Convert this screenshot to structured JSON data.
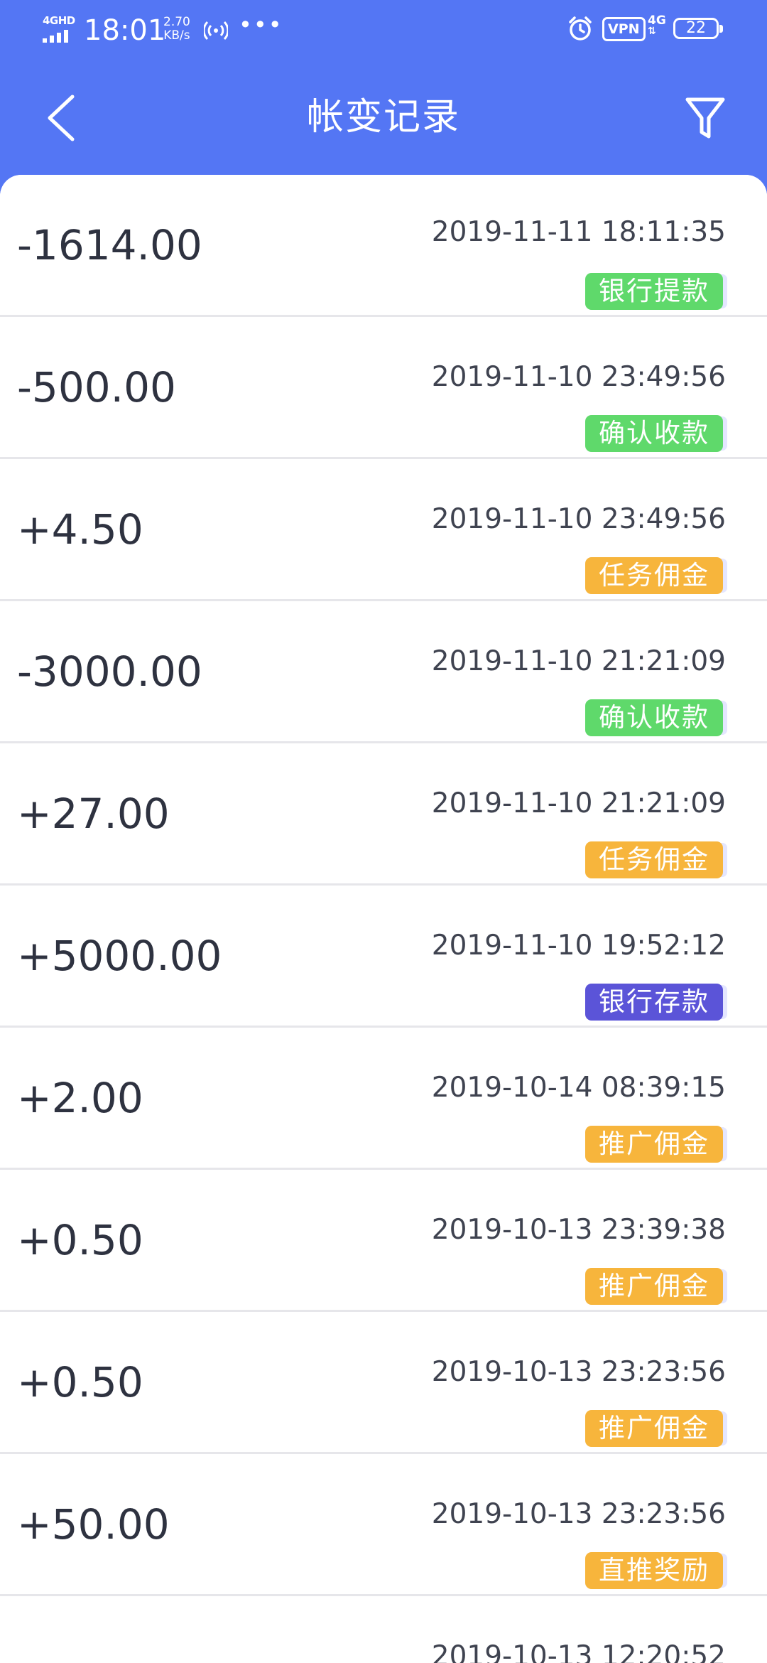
{
  "status_bar": {
    "network_type": "4GHD",
    "time": "18:01",
    "speed_value": "2.70",
    "speed_unit": "KB/s",
    "more": "•••",
    "vpn": "VPN",
    "cell": "4G",
    "battery": "22"
  },
  "nav": {
    "title": "帐变记录",
    "back_icon": "chevron-left-icon",
    "filter_icon": "filter-funnel-icon"
  },
  "colors": {
    "header": "#5476f4",
    "green": "#5fd96b",
    "orange": "#f7b53c",
    "purple": "#5b54d8"
  },
  "records": [
    {
      "amount": "-1614.00",
      "time": "2019-11-11 18:11:35",
      "tag": "银行提款",
      "tag_color": "#5fd96b"
    },
    {
      "amount": "-500.00",
      "time": "2019-11-10 23:49:56",
      "tag": "确认收款",
      "tag_color": "#5fd96b"
    },
    {
      "amount": "+4.50",
      "time": "2019-11-10 23:49:56",
      "tag": "任务佣金",
      "tag_color": "#f7b53c"
    },
    {
      "amount": "-3000.00",
      "time": "2019-11-10 21:21:09",
      "tag": "确认收款",
      "tag_color": "#5fd96b"
    },
    {
      "amount": "+27.00",
      "time": "2019-11-10 21:21:09",
      "tag": "任务佣金",
      "tag_color": "#f7b53c"
    },
    {
      "amount": "+5000.00",
      "time": "2019-11-10 19:52:12",
      "tag": "银行存款",
      "tag_color": "#5b54d8"
    },
    {
      "amount": "+2.00",
      "time": "2019-10-14 08:39:15",
      "tag": "推广佣金",
      "tag_color": "#f7b53c"
    },
    {
      "amount": "+0.50",
      "time": "2019-10-13 23:39:38",
      "tag": "推广佣金",
      "tag_color": "#f7b53c"
    },
    {
      "amount": "+0.50",
      "time": "2019-10-13 23:23:56",
      "tag": "推广佣金",
      "tag_color": "#f7b53c"
    },
    {
      "amount": "+50.00",
      "time": "2019-10-13 23:23:56",
      "tag": "直推奖励",
      "tag_color": "#f7b53c"
    },
    {
      "amount": "",
      "time": "2019-10-13 12:20:52",
      "tag": "",
      "tag_color": "#f7b53c"
    }
  ]
}
